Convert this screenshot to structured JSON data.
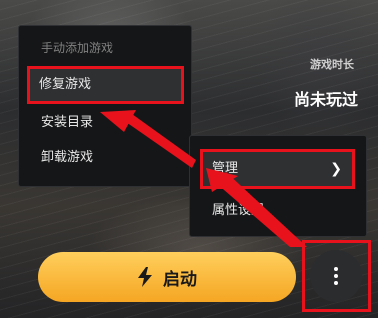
{
  "info": {
    "label": "游戏时长",
    "value": "尚未玩过"
  },
  "context_menu": {
    "header": "手动添加游戏",
    "items": [
      {
        "label": "修复游戏",
        "highlighted": true
      },
      {
        "label": "安装目录"
      },
      {
        "label": "卸载游戏"
      }
    ]
  },
  "submenu": {
    "items": [
      {
        "label": "管理",
        "has_submenu": true,
        "highlighted": true
      },
      {
        "label": "属性设置"
      }
    ]
  },
  "launch_button": {
    "label": "启动",
    "icon": "lightning-bolt-icon"
  },
  "more_button": {
    "icon": "vertical-ellipsis-icon"
  },
  "colors": {
    "accent": "#f5a623",
    "highlight": "#e8121c",
    "menu_bg": "#151617"
  }
}
